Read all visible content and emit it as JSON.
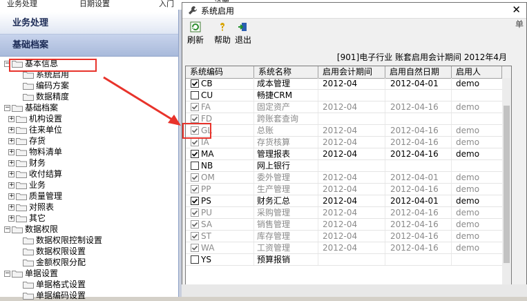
{
  "top_strip": [
    "业务处理",
    "日期设置",
    "入门",
    "设置"
  ],
  "nav": {
    "section1": "业务处理",
    "section2": "基础档案"
  },
  "tree": [
    {
      "label": "基本信息",
      "level": 0,
      "expander": "−"
    },
    {
      "label": "系统启用",
      "level": 1,
      "expander": ""
    },
    {
      "label": "编码方案",
      "level": 1,
      "expander": ""
    },
    {
      "label": "数据精度",
      "level": 1,
      "expander": ""
    },
    {
      "label": "基础档案",
      "level": 0,
      "expander": "−"
    },
    {
      "label": "机构设置",
      "level": 1,
      "expander": "+"
    },
    {
      "label": "往来单位",
      "level": 1,
      "expander": "+"
    },
    {
      "label": "存货",
      "level": 1,
      "expander": "+"
    },
    {
      "label": "物料清单",
      "level": 1,
      "expander": "+"
    },
    {
      "label": "财务",
      "level": 1,
      "expander": "+"
    },
    {
      "label": "收付结算",
      "level": 1,
      "expander": "+"
    },
    {
      "label": "业务",
      "level": 1,
      "expander": "+"
    },
    {
      "label": "质量管理",
      "level": 1,
      "expander": "+"
    },
    {
      "label": "对照表",
      "level": 1,
      "expander": "+"
    },
    {
      "label": "其它",
      "level": 1,
      "expander": "+"
    },
    {
      "label": "数据权限",
      "level": 0,
      "expander": "−"
    },
    {
      "label": "数据权限控制设置",
      "level": 1,
      "expander": ""
    },
    {
      "label": "数据权限设置",
      "level": 1,
      "expander": ""
    },
    {
      "label": "金额权限分配",
      "level": 1,
      "expander": ""
    },
    {
      "label": "单据设置",
      "level": 0,
      "expander": "−"
    },
    {
      "label": "单据格式设置",
      "level": 1,
      "expander": ""
    },
    {
      "label": "单据编码设置",
      "level": 1,
      "expander": ""
    }
  ],
  "dialog": {
    "title": "系统启用",
    "close_label": "✕",
    "toolbar": {
      "refresh": "刷新",
      "help": "帮助",
      "exit": "退出"
    },
    "info": "[901]电子行业 账套启用会计期间 2012年4月",
    "right_edge_text": "单",
    "columns": [
      "系统编码",
      "系统名称",
      "启用会计期间",
      "启用自然日期",
      "启用人"
    ],
    "rows": [
      {
        "checked": true,
        "disabled": false,
        "code": "CB",
        "name": "成本管理",
        "period": "2012-04",
        "date": "2012-04-01",
        "user": "demo"
      },
      {
        "checked": false,
        "disabled": false,
        "code": "CU",
        "name": "畅捷CRM",
        "period": "",
        "date": "",
        "user": ""
      },
      {
        "checked": true,
        "disabled": true,
        "code": "FA",
        "name": "固定资产",
        "period": "2012-04",
        "date": "2012-04-16",
        "user": "demo"
      },
      {
        "checked": true,
        "disabled": true,
        "code": "FD",
        "name": "跨账套查询",
        "period": "",
        "date": "",
        "user": ""
      },
      {
        "checked": true,
        "disabled": true,
        "code": "GL",
        "name": "总账",
        "period": "2012-04",
        "date": "2012-04-16",
        "user": "demo"
      },
      {
        "checked": true,
        "disabled": true,
        "code": "IA",
        "name": "存货核算",
        "period": "2012-04",
        "date": "2012-04-16",
        "user": "demo"
      },
      {
        "checked": true,
        "disabled": false,
        "code": "MA",
        "name": "管理报表",
        "period": "2012-04",
        "date": "2012-04-16",
        "user": "demo"
      },
      {
        "checked": false,
        "disabled": false,
        "code": "NB",
        "name": "网上银行",
        "period": "",
        "date": "",
        "user": ""
      },
      {
        "checked": true,
        "disabled": true,
        "code": "OM",
        "name": "委外管理",
        "period": "2012-04",
        "date": "2012-04-01",
        "user": "demo"
      },
      {
        "checked": true,
        "disabled": true,
        "code": "PP",
        "name": "生产管理",
        "period": "2012-04",
        "date": "2012-04-16",
        "user": "demo"
      },
      {
        "checked": true,
        "disabled": false,
        "code": "PS",
        "name": "财务汇总",
        "period": "2012-04",
        "date": "2012-04-01",
        "user": "demo"
      },
      {
        "checked": true,
        "disabled": true,
        "code": "PU",
        "name": "采购管理",
        "period": "2012-04",
        "date": "2012-04-16",
        "user": "demo"
      },
      {
        "checked": true,
        "disabled": true,
        "code": "SA",
        "name": "销售管理",
        "period": "2012-04",
        "date": "2012-04-16",
        "user": "demo"
      },
      {
        "checked": true,
        "disabled": true,
        "code": "ST",
        "name": "库存管理",
        "period": "2012-04",
        "date": "2012-04-16",
        "user": "demo"
      },
      {
        "checked": true,
        "disabled": true,
        "code": "WA",
        "name": "工资管理",
        "period": "2012-04",
        "date": "2012-04-16",
        "user": "demo"
      },
      {
        "checked": false,
        "disabled": false,
        "code": "YS",
        "name": "预算报销",
        "period": "",
        "date": "",
        "user": ""
      }
    ]
  },
  "colors": {
    "highlight": "#e8332b",
    "nav_text": "#1b2a55",
    "disabled_text": "#8a8a8a"
  }
}
